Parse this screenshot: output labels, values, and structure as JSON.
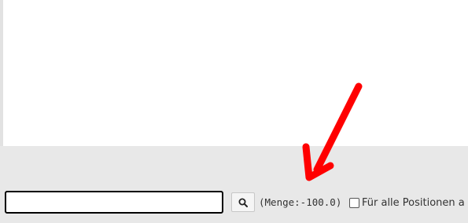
{
  "search": {
    "value": "",
    "placeholder": ""
  },
  "search_button": {
    "icon": "magnifier-icon"
  },
  "quantity_text": "(Menge:-100.0)",
  "all_positions": {
    "label": "Für alle Positionen a",
    "checked": false
  },
  "annotation": {
    "arrow_color": "#ff0000"
  },
  "colors": {
    "toolbar_background": "#e8e8e8",
    "panel_background": "#ffffff"
  }
}
